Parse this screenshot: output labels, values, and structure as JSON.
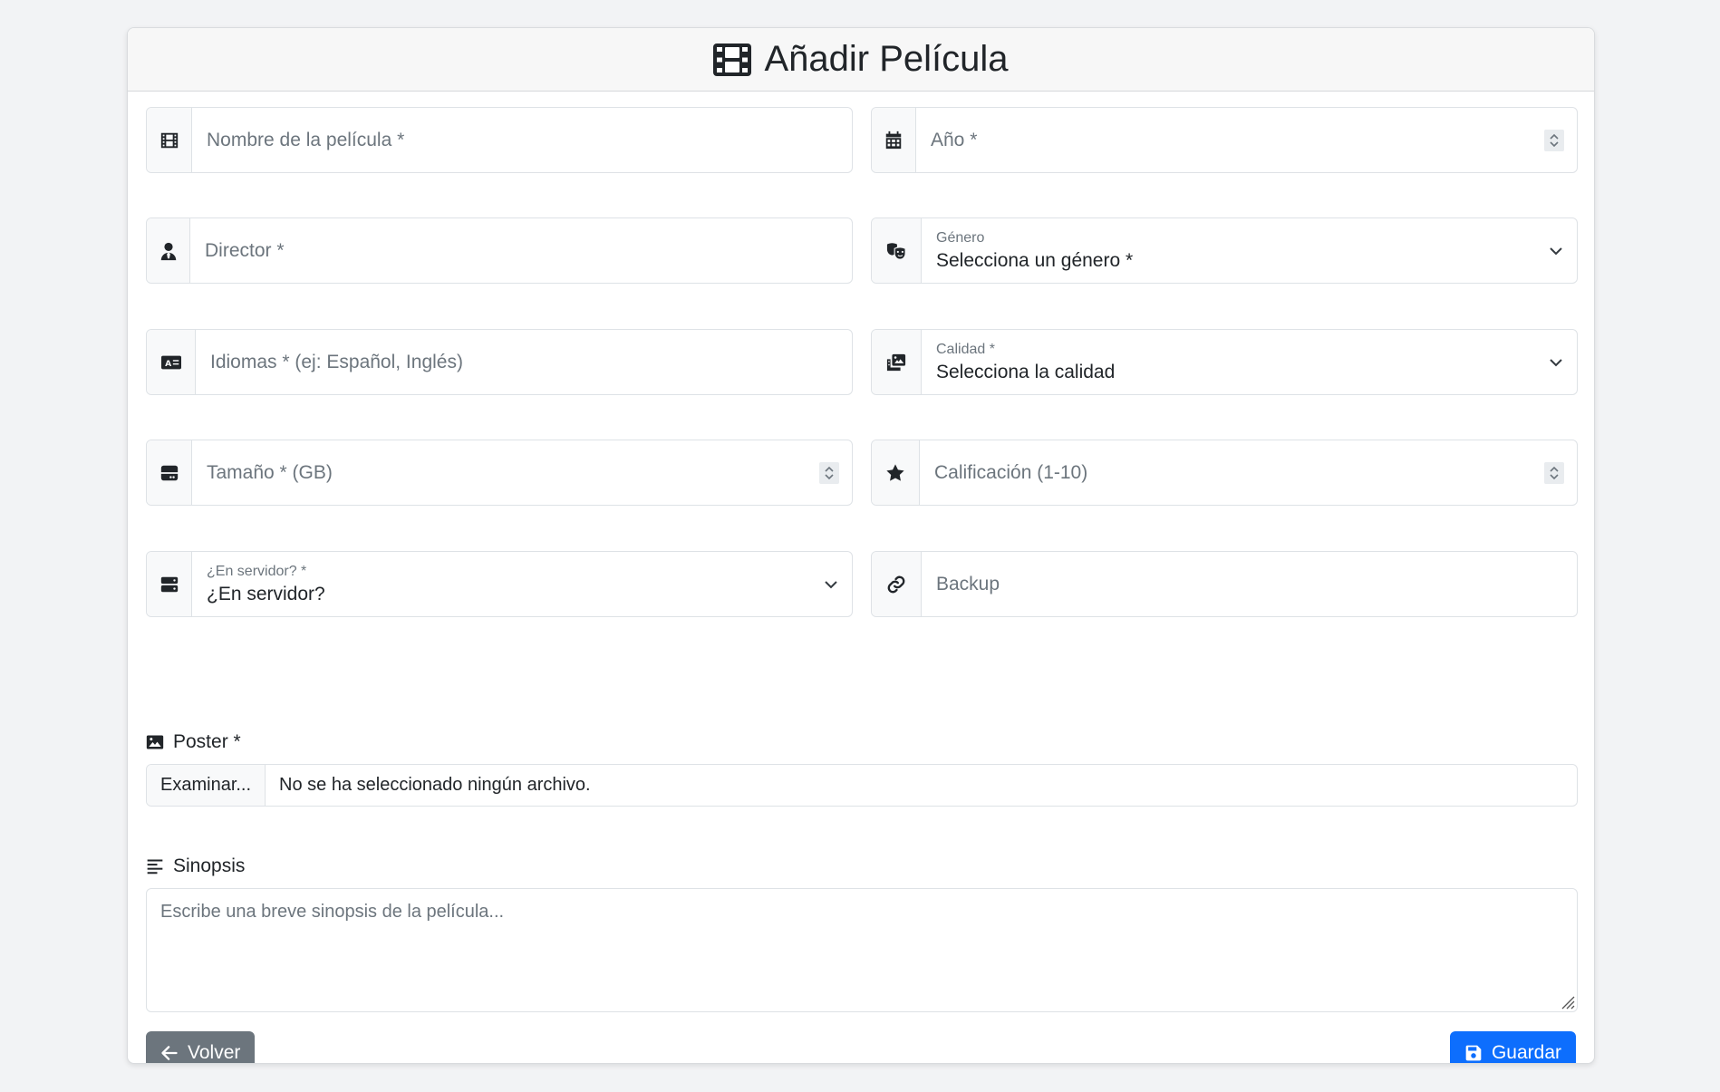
{
  "header": {
    "title": "Añadir Película",
    "icon": "film-icon"
  },
  "fields": {
    "nombre": {
      "placeholder": "Nombre de la película *",
      "icon": "film-icon"
    },
    "anio": {
      "placeholder": "Año *",
      "icon": "calendar-icon"
    },
    "director": {
      "placeholder": "Director *",
      "icon": "user-tie-icon"
    },
    "genero": {
      "label": "Género",
      "value": "Selecciona un género *",
      "icon": "masks-theater-icon"
    },
    "idiomas": {
      "placeholder": "Idiomas * (ej: Español, Inglés)",
      "icon": "language-icon"
    },
    "calidad": {
      "label": "Calidad *",
      "value": "Selecciona la calidad",
      "icon": "photo-film-icon"
    },
    "tamano": {
      "placeholder": "Tamaño * (GB)",
      "icon": "hard-drive-icon"
    },
    "calificacion": {
      "placeholder": "Calificación (1-10)",
      "icon": "star-icon"
    },
    "servidor": {
      "label": "¿En servidor? *",
      "value": "¿En servidor?",
      "icon": "server-icon"
    },
    "backup": {
      "placeholder": "Backup",
      "icon": "link-icon"
    }
  },
  "poster": {
    "label": "Poster *",
    "button": "Examinar...",
    "status": "No se ha seleccionado ningún archivo.",
    "icon": "image-icon"
  },
  "sinopsis": {
    "label": "Sinopsis",
    "placeholder": "Escribe una breve sinopsis de la película...",
    "icon": "align-left-icon"
  },
  "actions": {
    "back_label": "Volver",
    "save_label": "Guardar"
  },
  "colors": {
    "primary": "#0d6efd",
    "secondary": "#6c757d",
    "background": "#f2f3f5"
  }
}
